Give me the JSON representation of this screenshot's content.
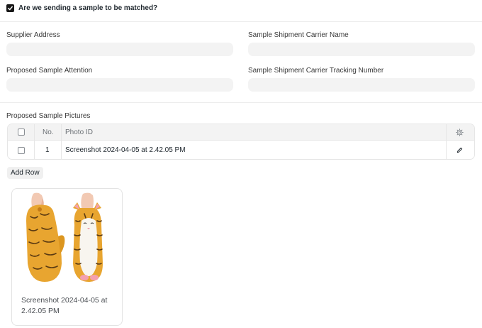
{
  "match_sample": {
    "label": "Are we sending a sample to be matched?",
    "checked": true
  },
  "fields": {
    "supplier_address": {
      "label": "Supplier Address",
      "value": ""
    },
    "sample_shipment_carrier_name": {
      "label": "Sample Shipment Carrier Name",
      "value": ""
    },
    "proposed_sample_attention": {
      "label": "Proposed Sample Attention",
      "value": ""
    },
    "sample_shipment_carrier_tracking_number": {
      "label": "Sample Shipment Carrier Tracking Number",
      "value": ""
    }
  },
  "pictures_table": {
    "title": "Proposed Sample Pictures",
    "columns": {
      "no": "No.",
      "photo_id": "Photo ID"
    },
    "rows": [
      {
        "no": "1",
        "photo_id": "Screenshot 2024-04-05 at 2.42.05 PM"
      }
    ],
    "settings_icon": "gear-icon",
    "edit_icon": "pencil-icon"
  },
  "add_row_label": "Add Row",
  "preview_card": {
    "caption": "Screenshot 2024-04-05 at 2.42.05 PM",
    "image": "cat-oven-mitts-image"
  }
}
